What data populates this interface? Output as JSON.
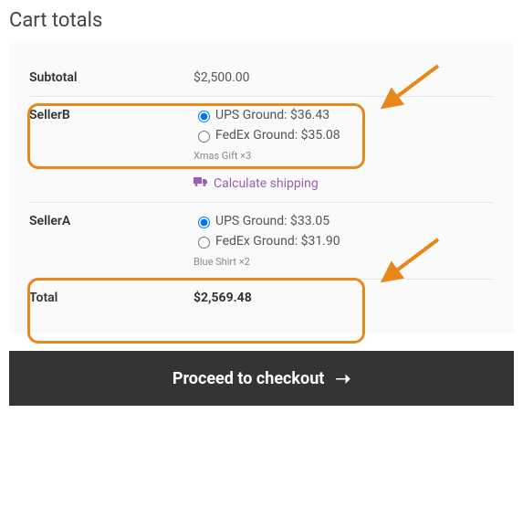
{
  "title": "Cart totals",
  "subtotal": {
    "label": "Subtotal",
    "value": "$2,500.00"
  },
  "sellers": [
    {
      "name": "SellerB",
      "options": [
        {
          "id": "b-ups",
          "label": "UPS Ground: $36.43",
          "checked": true
        },
        {
          "id": "b-fedex",
          "label": "FedEx Ground: $35.08",
          "checked": false
        }
      ],
      "item_note": "Xmas Gift ×3",
      "show_calc": true
    },
    {
      "name": "SellerA",
      "options": [
        {
          "id": "a-ups",
          "label": "UPS Ground: $33.05",
          "checked": true
        },
        {
          "id": "a-fedex",
          "label": "FedEx Ground: $31.90",
          "checked": false
        }
      ],
      "item_note": "Blue Shirt ×2",
      "show_calc": false
    }
  ],
  "calc_shipping_label": "Calculate shipping",
  "total": {
    "label": "Total",
    "value": "$2,569.48"
  },
  "checkout_label": "Proceed to checkout"
}
